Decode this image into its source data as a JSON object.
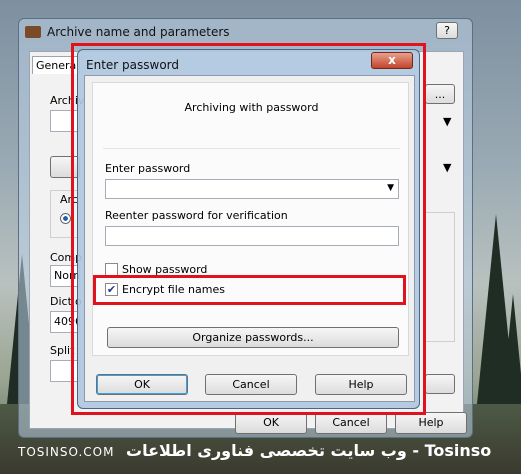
{
  "bg_window": {
    "title": "Archive name and parameters",
    "help_icon": "?",
    "tab_general": "Genera",
    "archive_label": "Archiv",
    "archive_radio_label": "Arc",
    "compression_label": "Comp",
    "compression_value": "Norm",
    "dictionary_label": "Dictio",
    "dictionary_value": "4096",
    "split_label": "Split",
    "browse_label": "...",
    "ok_label": "OK",
    "cancel_label": "Cancel",
    "help_label": "Help"
  },
  "dialog": {
    "title": "Enter password",
    "close_glyph": "x",
    "header": "Archiving with password",
    "password_label": "Enter password",
    "password_value": "",
    "reenter_label": "Reenter password for verification",
    "reenter_value": "",
    "show_password_label": "Show password",
    "show_password_checked": false,
    "encrypt_label": "Encrypt file names",
    "encrypt_checked": true,
    "organize_label": "Organize passwords...",
    "ok_label": "OK",
    "cancel_label": "Cancel",
    "help_label": "Help",
    "check_glyph": "✔"
  },
  "watermark": {
    "left": "TOSINSO.COM",
    "right": "وب سایت تخصصی فناوری اطلاعات - Tosinso"
  },
  "colors": {
    "highlight": "#e0121e"
  }
}
